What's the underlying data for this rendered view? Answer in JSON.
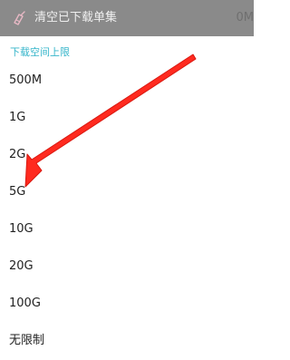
{
  "top_row": {
    "label": "清空已下载单集",
    "value": "0M",
    "icon": "broom-icon"
  },
  "sheet": {
    "title": "下载空间上限",
    "options": [
      {
        "label": "500M"
      },
      {
        "label": "1G"
      },
      {
        "label": "2G"
      },
      {
        "label": "5G"
      },
      {
        "label": "10G"
      },
      {
        "label": "20G"
      },
      {
        "label": "100G"
      },
      {
        "label": "无限制"
      }
    ]
  },
  "colors": {
    "accent": "#35b5ca",
    "annotation_arrow": "#ff2a1f",
    "dim_overlay": "#8a8a8a"
  }
}
